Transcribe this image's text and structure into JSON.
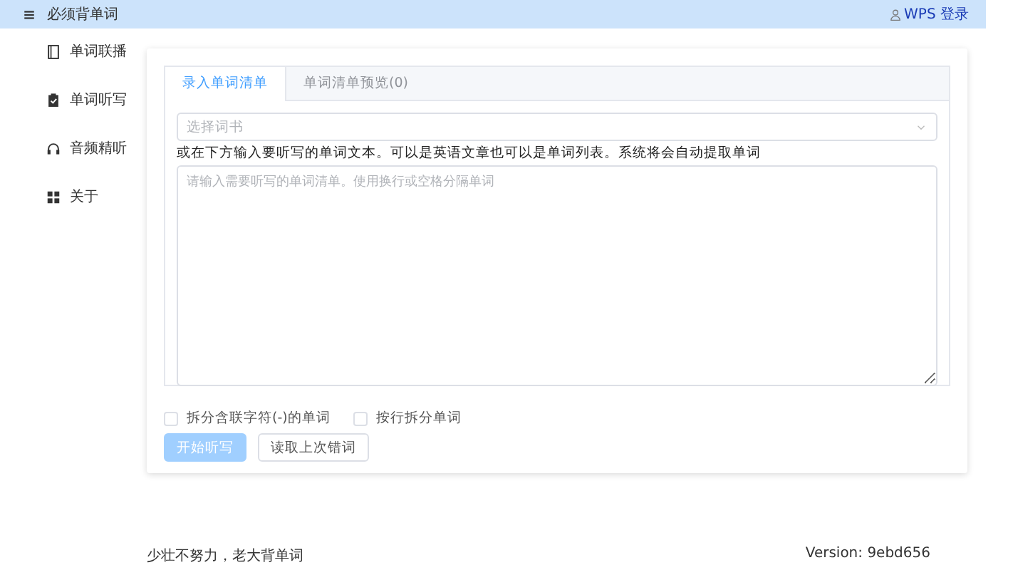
{
  "header": {
    "title": "必须背单词",
    "login": "WPS 登录"
  },
  "sidebar": {
    "items": [
      {
        "label": "单词联播"
      },
      {
        "label": "单词听写"
      },
      {
        "label": "音频精听"
      },
      {
        "label": "关于"
      }
    ]
  },
  "tabs": [
    {
      "label": "录入单词清单",
      "selected": true
    },
    {
      "label": "单词清单预览(0)",
      "selected": false
    }
  ],
  "book_select": {
    "placeholder": "选择词书"
  },
  "instruction": "或在下方输入要听写的单词文本。可以是英语文章也可以是单词列表。系统将会自动提取单词",
  "word_input": {
    "placeholder": "请输入需要听写的单词清单。使用换行或空格分隔单词"
  },
  "options": [
    {
      "label": "拆分含联字符(-)的单词",
      "checked": false
    },
    {
      "label": "按行拆分单词",
      "checked": false
    }
  ],
  "buttons": [
    {
      "label": "开始听写",
      "kind": "primary",
      "disabled": true
    },
    {
      "label": "读取上次错词",
      "kind": "default",
      "disabled": false
    }
  ],
  "footer": {
    "motto": "少壮不努力，老大背单词",
    "version": "Version: 9ebd656"
  }
}
